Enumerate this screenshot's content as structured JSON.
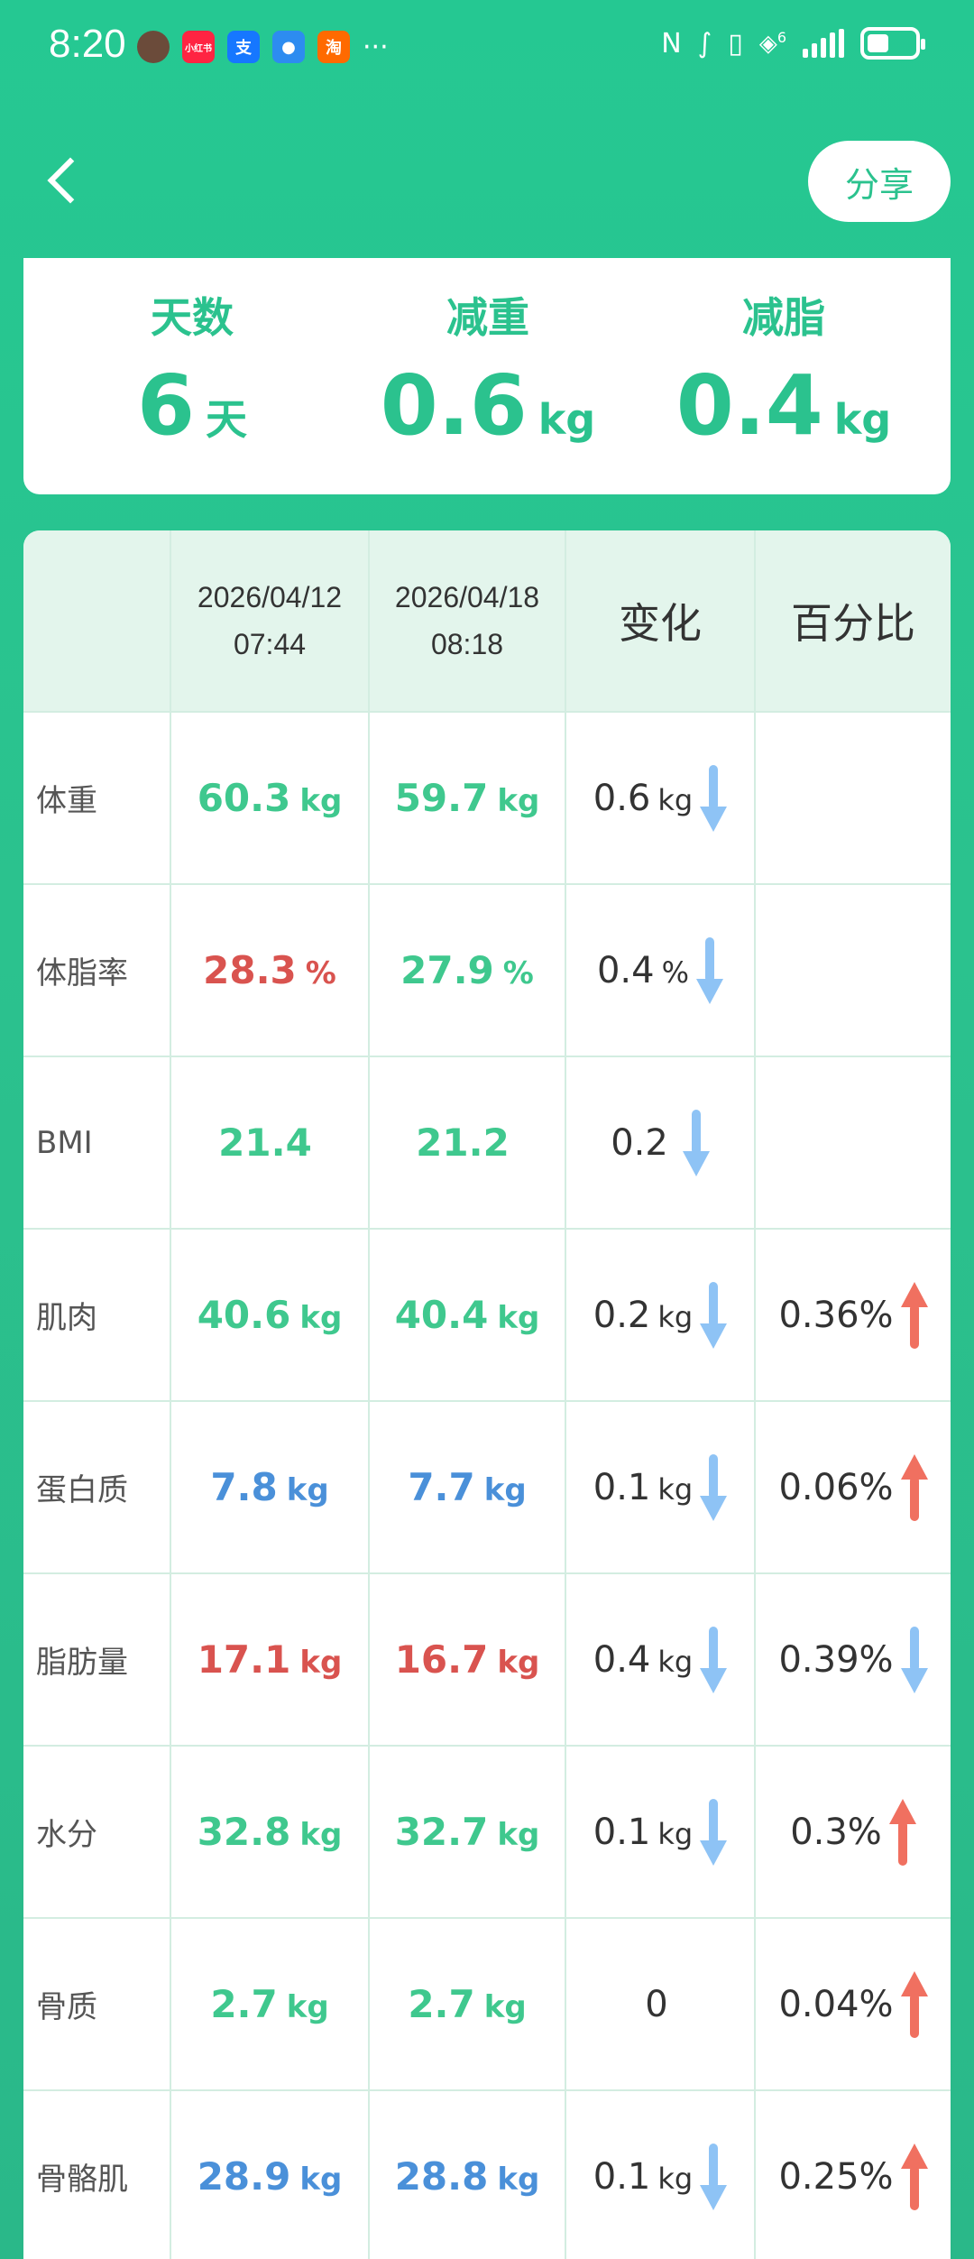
{
  "status_bar": {
    "time": "8:20",
    "apps": [
      "avatar",
      "小红书",
      "支",
      "msg",
      "淘"
    ],
    "more": "···",
    "network": "6",
    "battery_level": 0.45
  },
  "header": {
    "share_label": "分享"
  },
  "summary": {
    "days_label": "天数",
    "days_value": "6",
    "days_unit": "天",
    "weight_loss_label": "减重",
    "weight_loss_value": "0.6",
    "weight_loss_unit": "kg",
    "fat_loss_label": "减脂",
    "fat_loss_value": "0.4",
    "fat_loss_unit": "kg"
  },
  "table": {
    "header": {
      "date1_line1": "2026/04/12",
      "date1_line2": "07:44",
      "date2_line1": "2026/04/18",
      "date2_line2": "08:18",
      "change": "变化",
      "percent": "百分比"
    },
    "rows": [
      {
        "name": "体重",
        "v1": "60.3",
        "v1_unit": "kg",
        "v1_color": "green",
        "v2": "59.7",
        "v2_unit": "kg",
        "v2_color": "green",
        "change": "0.6",
        "change_unit": "kg",
        "change_dir": "down",
        "pct": "",
        "pct_dir": ""
      },
      {
        "name": "体脂率",
        "v1": "28.3",
        "v1_unit": "%",
        "v1_color": "red",
        "v2": "27.9",
        "v2_unit": "%",
        "v2_color": "green",
        "change": "0.4",
        "change_unit": "%",
        "change_dir": "down",
        "pct": "",
        "pct_dir": ""
      },
      {
        "name": "BMI",
        "v1": "21.4",
        "v1_unit": "",
        "v1_color": "green",
        "v2": "21.2",
        "v2_unit": "",
        "v2_color": "green",
        "change": "0.2",
        "change_unit": "",
        "change_dir": "down",
        "pct": "",
        "pct_dir": ""
      },
      {
        "name": "肌肉",
        "v1": "40.6",
        "v1_unit": "kg",
        "v1_color": "green",
        "v2": "40.4",
        "v2_unit": "kg",
        "v2_color": "green",
        "change": "0.2",
        "change_unit": "kg",
        "change_dir": "down",
        "pct": "0.36%",
        "pct_dir": "up"
      },
      {
        "name": "蛋白质",
        "v1": "7.8",
        "v1_unit": "kg",
        "v1_color": "blue",
        "v2": "7.7",
        "v2_unit": "kg",
        "v2_color": "blue",
        "change": "0.1",
        "change_unit": "kg",
        "change_dir": "down",
        "pct": "0.06%",
        "pct_dir": "up"
      },
      {
        "name": "脂肪量",
        "v1": "17.1",
        "v1_unit": "kg",
        "v1_color": "red",
        "v2": "16.7",
        "v2_unit": "kg",
        "v2_color": "red",
        "change": "0.4",
        "change_unit": "kg",
        "change_dir": "down",
        "pct": "0.39%",
        "pct_dir": "down"
      },
      {
        "name": "水分",
        "v1": "32.8",
        "v1_unit": "kg",
        "v1_color": "green",
        "v2": "32.7",
        "v2_unit": "kg",
        "v2_color": "green",
        "change": "0.1",
        "change_unit": "kg",
        "change_dir": "down",
        "pct": "0.3%",
        "pct_dir": "up"
      },
      {
        "name": "骨质",
        "v1": "2.7",
        "v1_unit": "kg",
        "v1_color": "green",
        "v2": "2.7",
        "v2_unit": "kg",
        "v2_color": "green",
        "change": "0",
        "change_unit": "",
        "change_dir": "",
        "pct": "0.04%",
        "pct_dir": "up"
      },
      {
        "name": "骨骼肌",
        "v1": "28.9",
        "v1_unit": "kg",
        "v1_color": "blue",
        "v2": "28.8",
        "v2_unit": "kg",
        "v2_color": "blue",
        "change": "0.1",
        "change_unit": "kg",
        "change_dir": "down",
        "pct": "0.25%",
        "pct_dir": "up"
      }
    ]
  }
}
